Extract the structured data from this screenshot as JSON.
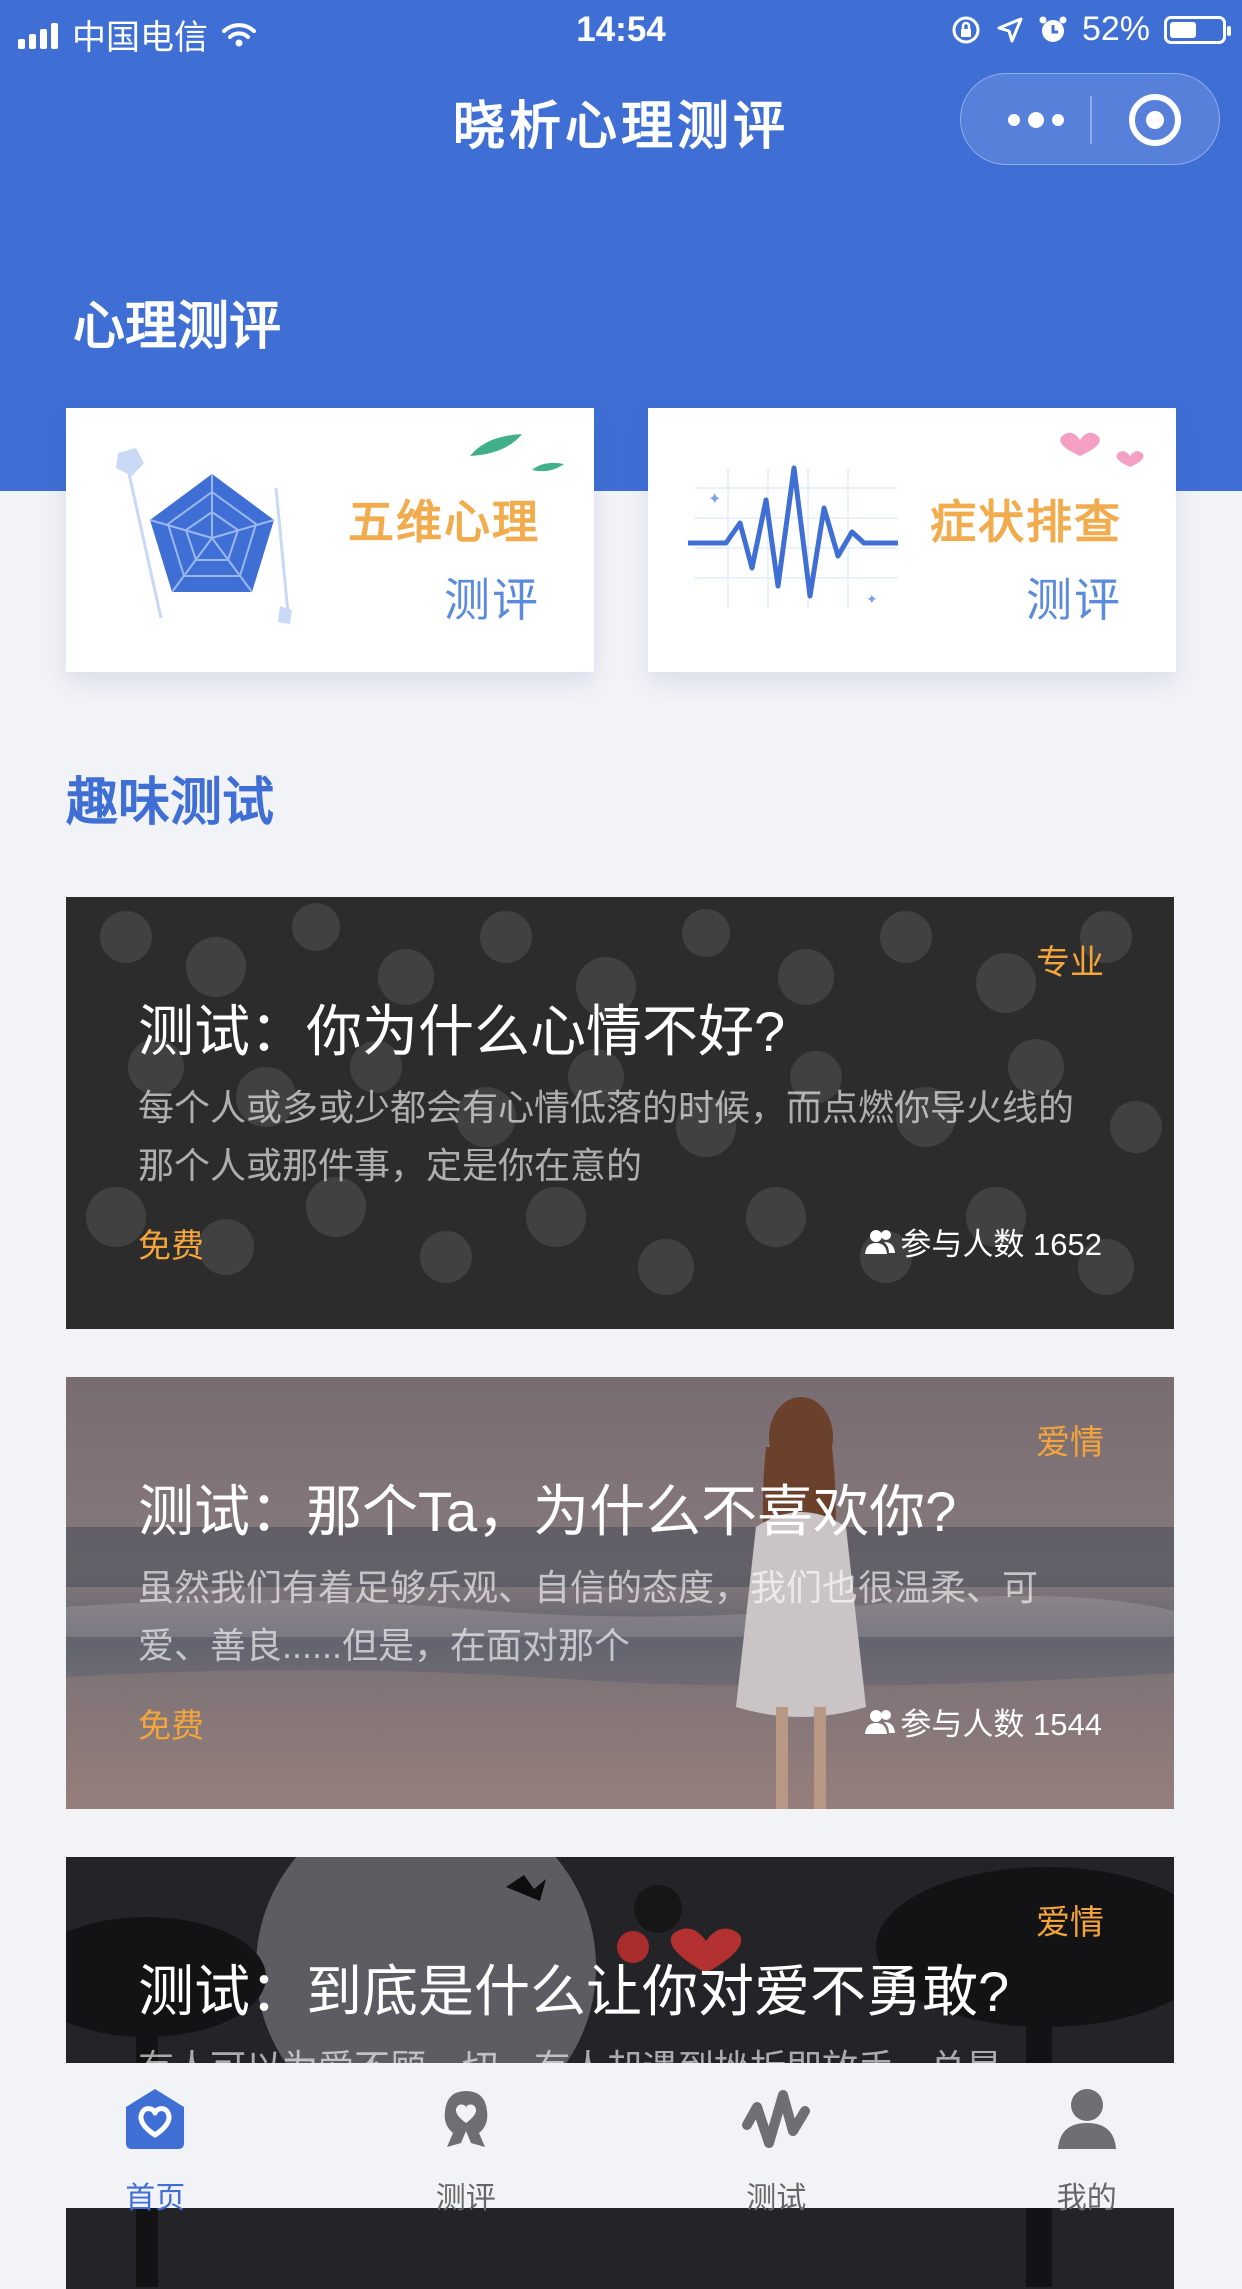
{
  "status_bar": {
    "carrier": "中国电信",
    "time": "14:54",
    "battery": "52%",
    "battery_level": 0.52
  },
  "header": {
    "title": "晓析心理测评",
    "menu_icon": "more-dots-icon",
    "close_icon": "target-circle-icon"
  },
  "psych_section": {
    "title": "心理测评",
    "cards": [
      {
        "line1": "五维心理",
        "line2": "测评",
        "icon": "pentagon-radar-illustration"
      },
      {
        "line1": "症状排查",
        "line2": "测评",
        "icon": "heartbeat-illustration"
      }
    ]
  },
  "fun_section": {
    "title": "趣味测试",
    "tests": [
      {
        "tag": "专业",
        "title": "测试：你为什么心情不好?",
        "desc": "每个人或多或少都会有心情低落的时候，而点燃你导火线的那个人或那件事，定是你在意的",
        "price": "免费",
        "count": "参与人数 1652"
      },
      {
        "tag": "爱情",
        "title": "测试：那个Ta，为什么不喜欢你?",
        "desc": "虽然我们有着足够乐观、自信的态度，我们也很温柔、可爱、善良......但是，在面对那个",
        "price": "免费",
        "count": "参与人数 1544"
      },
      {
        "tag": "爱情",
        "title": "测试：到底是什么让你对爱不勇敢?",
        "desc": "有人可以为爱不顾一切，有人却遇到挫折即放手，总是",
        "price": "",
        "count": ""
      }
    ]
  },
  "tabbar": {
    "items": [
      {
        "label": "首页",
        "icon": "home-heart-icon",
        "active": true
      },
      {
        "label": "测评",
        "icon": "evaluation-icon",
        "active": false
      },
      {
        "label": "测试",
        "icon": "test-wave-icon",
        "active": false
      },
      {
        "label": "我的",
        "icon": "user-icon",
        "active": false
      }
    ]
  },
  "colors": {
    "primary": "#3f6fd5",
    "accent": "#f0ac4d",
    "background": "#f2f3f7"
  }
}
